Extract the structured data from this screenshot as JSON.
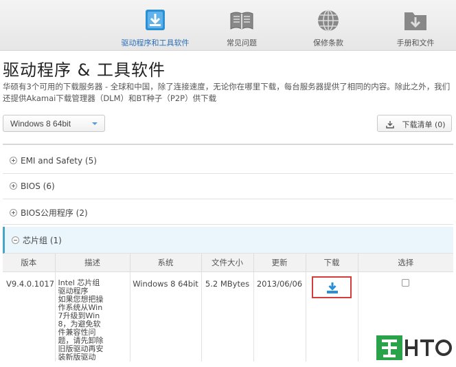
{
  "nav": {
    "items": [
      {
        "label": "驱动程序和工具软件",
        "icon": "download-icon",
        "active": true
      },
      {
        "label": "常见问题",
        "icon": "book-icon",
        "active": false
      },
      {
        "label": "保修条款",
        "icon": "globe-icon",
        "active": false
      },
      {
        "label": "手册和文件",
        "icon": "folder-download-icon",
        "active": false
      }
    ]
  },
  "page": {
    "title": "驱动程序 & 工具软件",
    "description": "华硕有3个可用的下载服务器 - 全球和中国，除了连接速度，无论你在哪里下载，每台服务器提供了相同的内容。除此之外，我们还提供Akamai下载管理器（DLM）和BT种子（P2P）供下载"
  },
  "controls": {
    "os_selected": "Windows 8 64bit",
    "download_list_label": "下载清单 (0)"
  },
  "categories": [
    {
      "label": "EMI and Safety",
      "count": "(5)",
      "expanded": false
    },
    {
      "label": "BIOS",
      "count": "(6)",
      "expanded": false
    },
    {
      "label": "BIOS公用程序",
      "count": "(2)",
      "expanded": false
    },
    {
      "label": "芯片组",
      "count": "(1)",
      "expanded": true
    }
  ],
  "table": {
    "headers": [
      "版本",
      "描述",
      "系统",
      "文件大小",
      "更新",
      "下载",
      "选择"
    ],
    "rows": [
      {
        "version": "V9.4.0.1017",
        "description": "Intel 芯片组驱动程序\n如果您想把操作系统从Win 7升级到Win 8，为避免软件兼容性问题，请先卸除旧版驱动再安装新版驱动",
        "system": "Windows 8 64bit",
        "size": "5.2 MBytes",
        "updated": "2013/06/06"
      }
    ]
  },
  "colors": {
    "accent": "#2a6fb5",
    "download_icon": "#2b8fd4",
    "highlight_border": "#d43b3b",
    "expanded_bg": "#eaf6fb"
  }
}
